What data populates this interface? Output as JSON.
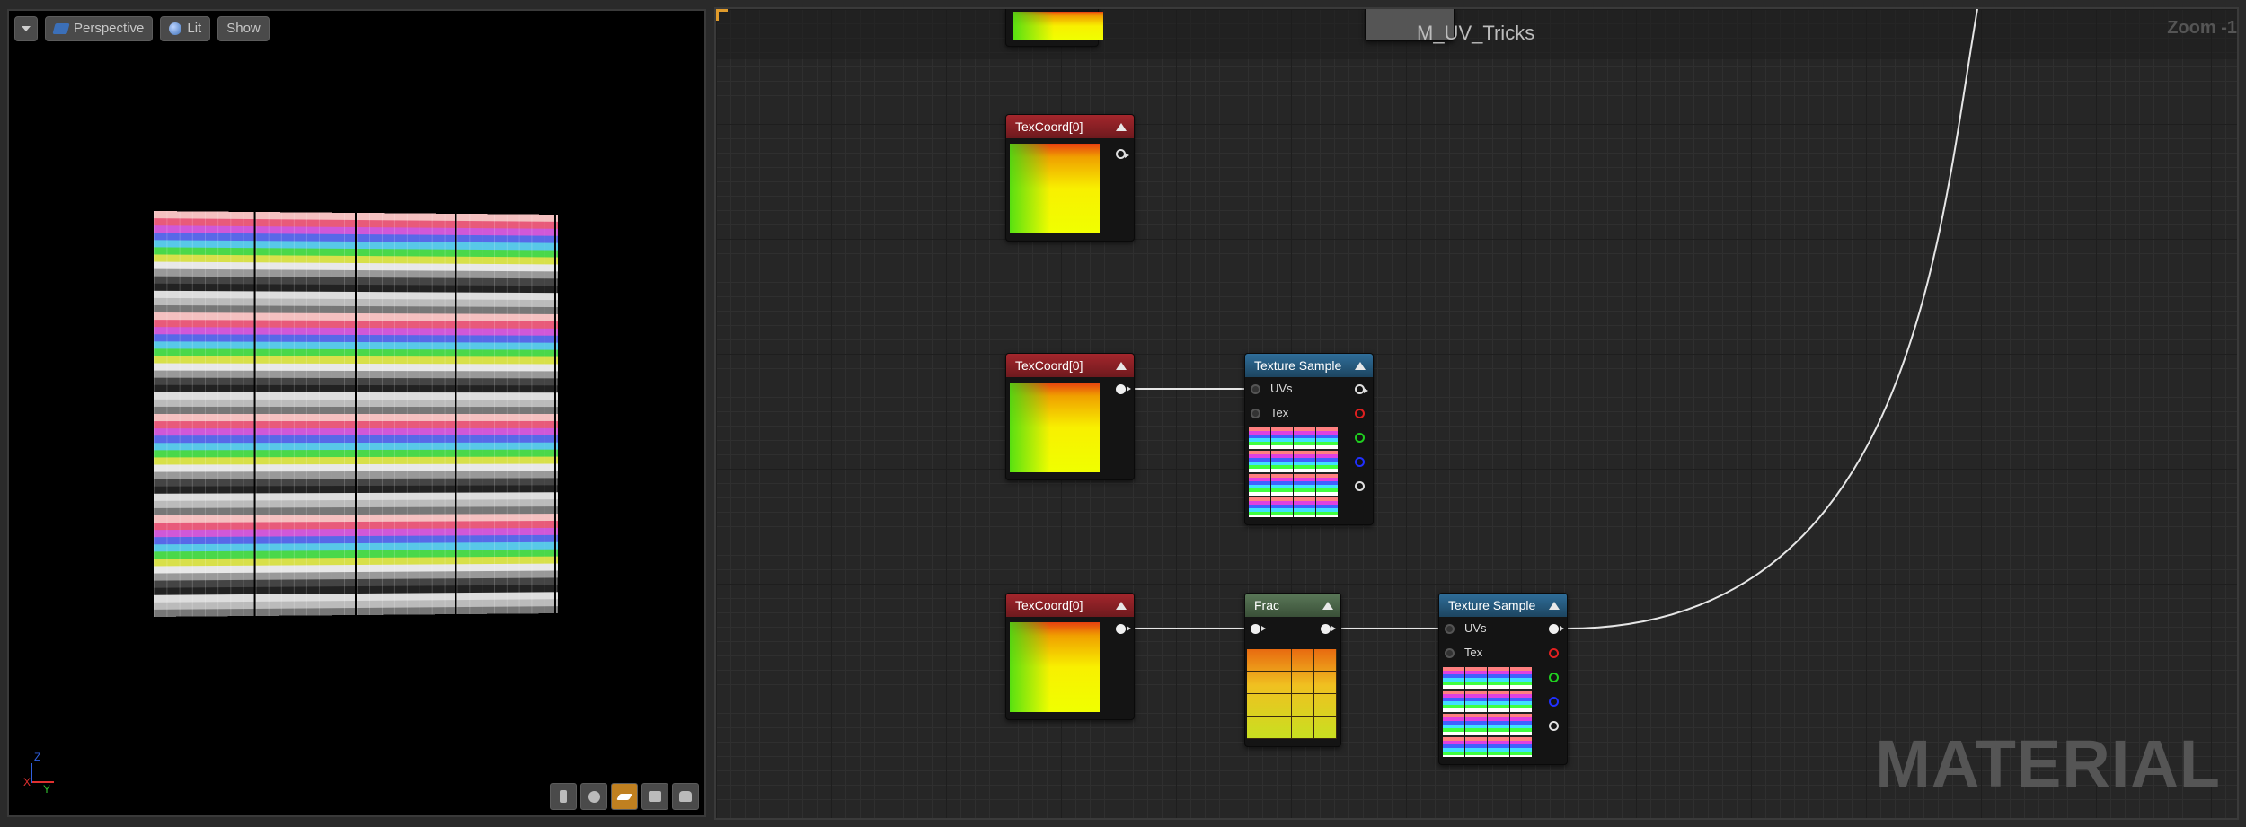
{
  "viewport": {
    "toolbar": {
      "menu_icon": "chevron-down-icon",
      "perspective_label": "Perspective",
      "lit_label": "Lit",
      "show_label": "Show"
    },
    "axis": {
      "z": "Z",
      "x": "X",
      "y": "Y"
    },
    "bottom_buttons": [
      "realtime-icon",
      "sphere-icon",
      "plane-icon",
      "cube-icon",
      "cylinder-icon"
    ]
  },
  "graph": {
    "title": "M_UV_Tricks",
    "zoom": "Zoom -1",
    "watermark": "MATERIAL",
    "nodes": {
      "texcoord_1": {
        "title": "TexCoord[0]"
      },
      "texcoord_2": {
        "title": "TexCoord[0]"
      },
      "texture_sample_1": {
        "title": "Texture Sample",
        "input_uvs": "UVs",
        "input_tex": "Tex"
      },
      "texcoord_3": {
        "title": "TexCoord[0]"
      },
      "frac": {
        "title": "Frac"
      },
      "texture_sample_2": {
        "title": "Texture Sample",
        "input_uvs": "UVs",
        "input_tex": "Tex"
      }
    },
    "colors": {
      "texcoord_header": "#a4262c",
      "texture_header": "#2f6e9a",
      "frac_header": "#5a7858",
      "selection_accent": "#e09b2c"
    }
  }
}
